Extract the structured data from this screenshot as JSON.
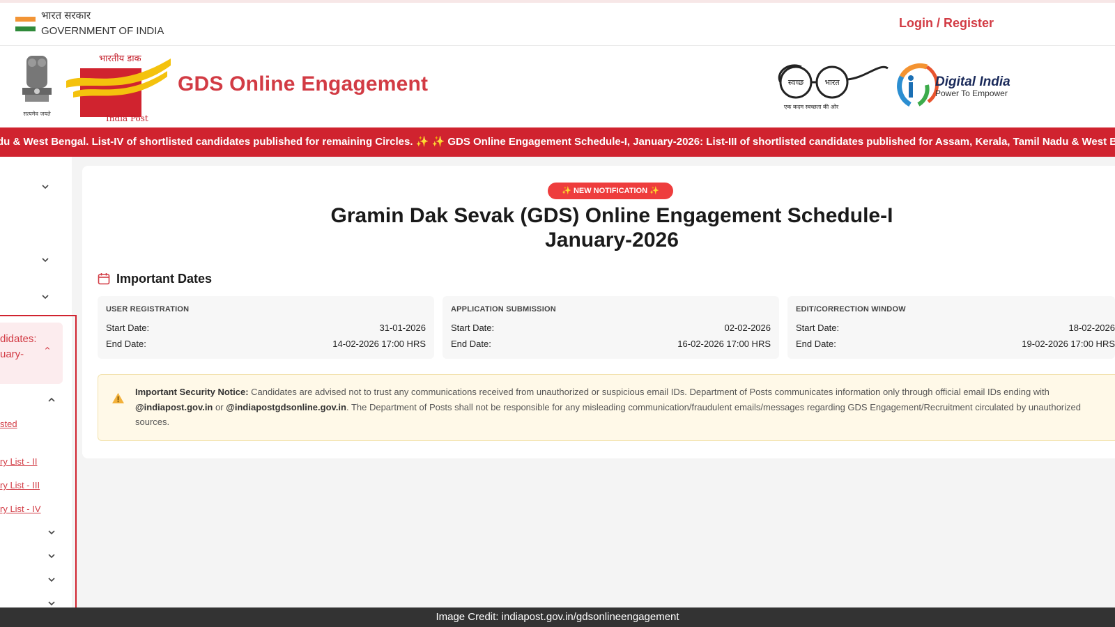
{
  "gov_bar": {
    "hindi": "भारत सरकार",
    "english": "GOVERNMENT OF INDIA",
    "login": "Login / Register"
  },
  "header": {
    "title": "GDS Online Engagement",
    "emblem_motto": "सत्यमेव जयते",
    "indiapost_hindi": "भारतीय डाक",
    "indiapost_label": "India Post",
    "swachh_left": "स्वच्छ",
    "swachh_right": "भारत",
    "swachh_tag": "एक कदम स्वच्छता की ओर",
    "digital_india": "Digital India",
    "digital_tag": "Power To Empower"
  },
  "ticker": {
    "text": "du & West Bengal. List-IV of shortlisted candidates published for remaining Circles. ✨      ✨ GDS Online Engagement Schedule-I, January-2026: List-III of shortlisted candidates published for Assam, Kerala, Tamil Nadu & West B"
  },
  "sidebar": {
    "candidates_line1": "didates:",
    "candidates_line2": "uary-",
    "links": [
      "sted",
      "ry List - II",
      "ry List - III",
      "ry List - IV"
    ]
  },
  "main": {
    "badge": "✨ NEW NOTIFICATION ✨",
    "headline_line1": "Gramin Dak Sevak (GDS) Online Engagement Schedule-I",
    "headline_line2": "January-2026",
    "dates_title": "Important Dates",
    "dates": [
      {
        "label": "USER REGISTRATION",
        "start_label": "Start Date:",
        "start": "31-01-2026",
        "end_label": "End Date:",
        "end": "14-02-2026 17:00 HRS"
      },
      {
        "label": "APPLICATION SUBMISSION",
        "start_label": "Start Date:",
        "start": "02-02-2026",
        "end_label": "End Date:",
        "end": "16-02-2026 17:00 HRS"
      },
      {
        "label": "EDIT/CORRECTION WINDOW",
        "start_label": "Start Date:",
        "start": "18-02-2026",
        "end_label": "End Date:",
        "end": "19-02-2026 17:00 HRS"
      }
    ],
    "notice_title": "Important Security Notice:",
    "notice_1": " Candidates are advised not to trust any communications received from unauthorized or suspicious email IDs. Department of Posts communicates information only through official email IDs ending with ",
    "notice_email1": "@indiapost.gov.in",
    "notice_or": " or ",
    "notice_email2": "@indiapostgdsonline.gov.in",
    "notice_2": ". The Department of Posts shall not be responsible for any misleading communication/fraudulent emails/messages regarding GDS Engagement/Recruitment circulated by unauthorized sources."
  },
  "caption": "Image Credit: indiapost.gov.in/gdsonlineengagement",
  "colors": {
    "brand_red": "#d23b44",
    "ticker_red": "#d0232f",
    "notice_bg": "#fff9e8"
  }
}
